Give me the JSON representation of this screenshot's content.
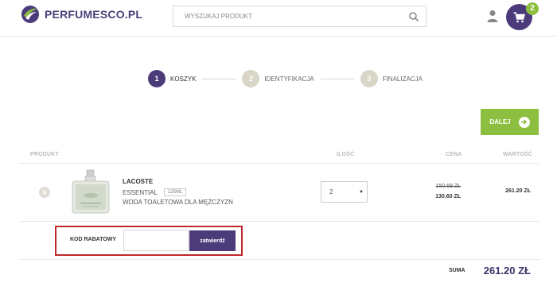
{
  "header": {
    "logo_text": "PERFUMESCO.PL",
    "search_placeholder": "WYSZUKAJ PRODUKT",
    "cart_count": "2",
    "colors": {
      "brand": "#4b3b7a",
      "accent": "#8cbf3f"
    }
  },
  "steps": [
    {
      "number": "1",
      "label": "KOSZYK",
      "active": true
    },
    {
      "number": "2",
      "label": "IDENTYFIKACJA",
      "active": false
    },
    {
      "number": "3",
      "label": "FINALIZACJA",
      "active": false
    }
  ],
  "next_button": {
    "label": "DALEJ",
    "icon": "arrow-right-circle-icon"
  },
  "table": {
    "headers": {
      "product": "PRODUKT",
      "quantity": "ILOŚĆ",
      "price": "CENA",
      "value": "WARTOŚĆ"
    },
    "rows": [
      {
        "brand": "LACOSTE",
        "line": "ESSENTIAL",
        "size": "125ML",
        "description": "WODA TOALETOWA DLA MĘŻCZYZN",
        "quantity": "2",
        "old_price": "150.69 ZŁ",
        "price": "130.60 ZŁ",
        "value": "261.20 ZŁ"
      }
    ]
  },
  "coupon": {
    "label": "KOD RABATOWY",
    "value": "",
    "button_label": "zatwierdź"
  },
  "summary": {
    "label": "SUMA",
    "value": "261.20 ZŁ"
  }
}
